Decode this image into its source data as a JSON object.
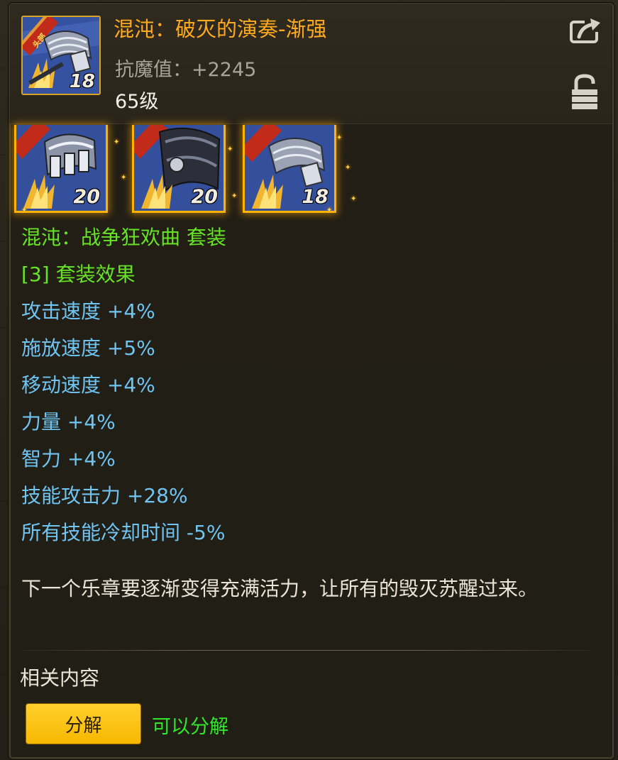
{
  "item": {
    "name": "混沌：破灭的演奏-渐强",
    "stat_label": "抗魔值：",
    "stat_value": "+2245",
    "level_text": "65级",
    "icon_level": "18",
    "icon_ribbon_text": "头部"
  },
  "set": {
    "pieces": [
      {
        "level": "20"
      },
      {
        "level": "20"
      },
      {
        "level": "18"
      }
    ],
    "name": "混沌：战争狂欢曲 套装",
    "effect_header": "[3] 套装效果",
    "bonuses": [
      "攻击速度 +4%",
      "施放速度 +5%",
      "移动速度 +4%",
      "力量 +4%",
      "智力 +4%",
      "技能攻击力 +28%",
      "所有技能冷却时间 -5%"
    ]
  },
  "flavor": "下一个乐章要逐渐变得充满活力，让所有的毁灭苏醒过来。",
  "related_label": "相关内容",
  "actions": {
    "decompose_label": "分解",
    "decompose_note": "可以分解"
  },
  "colors": {
    "title": "#ffaa1e",
    "set_name": "#67e326",
    "bonus": "#6fc4f2",
    "button": "#fcc41a",
    "decompose_note": "#31e62b"
  },
  "icons": [
    "share-icon",
    "lock-icon"
  ]
}
